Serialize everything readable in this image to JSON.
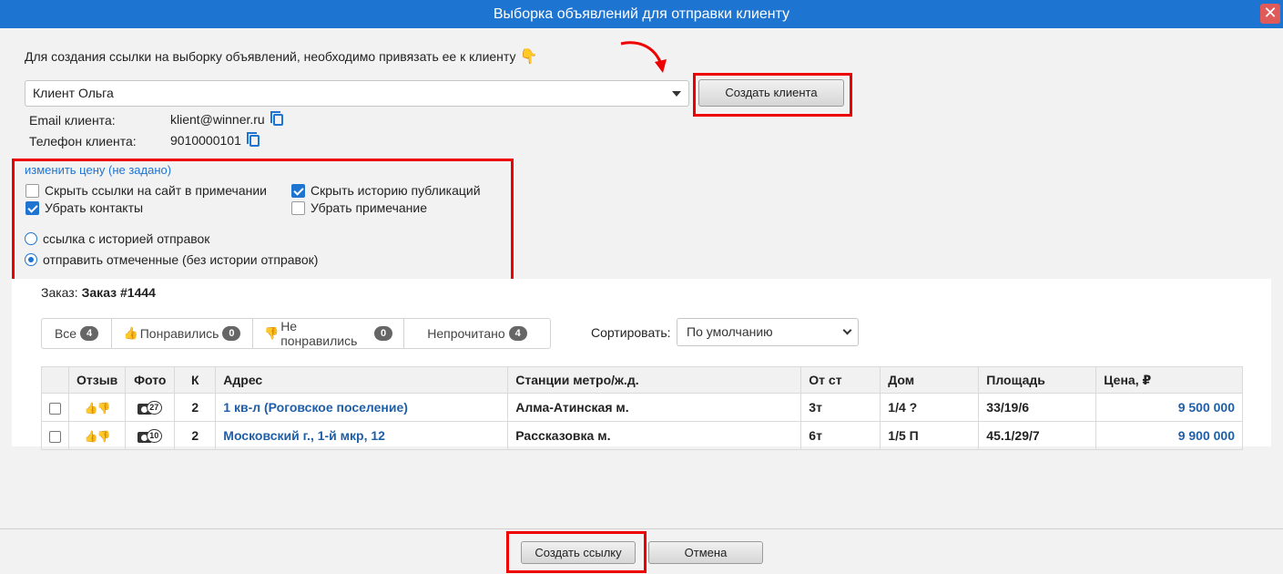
{
  "window": {
    "title": "Выборка объявлений для отправки клиенту"
  },
  "intro": {
    "text": "Для создания ссылки на выборку объявлений, необходимо привязать ее к клиенту",
    "hand": "👇"
  },
  "client": {
    "selected": "Клиент Ольга",
    "create_button": "Создать клиента",
    "email_label": "Email клиента:",
    "email_value": "klient@winner.ru",
    "phone_label": "Телефон клиента:",
    "phone_value": "9010000101"
  },
  "options": {
    "price_link": "изменить цену (не задано)",
    "hide_site_links": {
      "label": "Скрыть ссылки на сайт в примечании",
      "checked": false
    },
    "hide_publication_history": {
      "label": "Скрыть историю публикаций",
      "checked": true
    },
    "remove_contacts": {
      "label": "Убрать контакты",
      "checked": true
    },
    "remove_note": {
      "label": "Убрать примечание",
      "checked": false
    },
    "radio_with_history": {
      "label": "ссылка с историей отправок",
      "selected": false
    },
    "radio_marked_only": {
      "label": "отправить отмеченные (без истории отправок)",
      "selected": true
    }
  },
  "order": {
    "label": "Заказ:",
    "value": "Заказ #1444"
  },
  "filters": [
    {
      "label": "Все",
      "count": "4"
    },
    {
      "label": "Понравились",
      "count": "0",
      "icon": "thumb-up-icon"
    },
    {
      "label": "Не понравились",
      "count": "0",
      "icon": "thumb-down-icon"
    },
    {
      "label": "Непрочитано",
      "count": "4"
    }
  ],
  "sort": {
    "label": "Сортировать:",
    "value": "По умолчанию"
  },
  "table": {
    "headers": [
      "",
      "Отзыв",
      "Фото",
      "К",
      "Адрес",
      "Станции метро/ж.д.",
      "От ст",
      "Дом",
      "Площадь",
      "Цена, ₽"
    ],
    "rows": [
      {
        "photos": "27",
        "rooms": "2",
        "address": "1 кв-л (Роговское поселение)",
        "station": "Алма-Атинская м.",
        "distance": "3т",
        "house": "1/4 ?",
        "area": "33/19/6",
        "price": "9 500 000"
      },
      {
        "photos": "10",
        "rooms": "2",
        "address": "Московский г., 1-й мкр, 12",
        "station": "Рассказовка м.",
        "distance": "6т",
        "house": "1/5 П",
        "area": "45.1/29/7",
        "price": "9 900 000"
      }
    ]
  },
  "footer": {
    "create_link_button": "Создать ссылку",
    "cancel_button": "Отмена"
  },
  "colors": {
    "accent": "#1e74d1",
    "highlight": "#e00000",
    "link": "#1f5fa8"
  }
}
